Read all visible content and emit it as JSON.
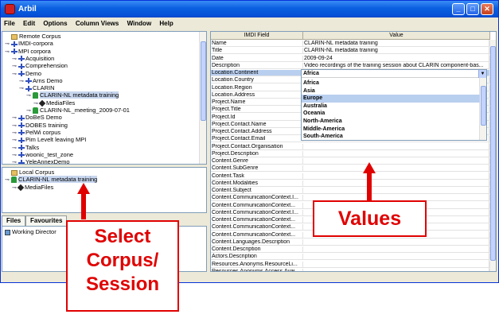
{
  "window": {
    "title": "Arbil"
  },
  "menubar": [
    "File",
    "Edit",
    "Options",
    "Column Views",
    "Window",
    "Help"
  ],
  "remote_tree": [
    {
      "label": "Remote Corpus",
      "icon": "folder-icon",
      "depth": 0
    },
    {
      "label": "IMDI-corpora",
      "icon": "corpus-node-icon",
      "depth": 0
    },
    {
      "label": "MPI corpora",
      "icon": "corpus-node-icon",
      "depth": 0
    },
    {
      "label": "Acquisition",
      "icon": "corpus-node-icon",
      "depth": 1
    },
    {
      "label": "Comprehension",
      "icon": "corpus-node-icon",
      "depth": 1
    },
    {
      "label": "Demo",
      "icon": "corpus-node-icon",
      "depth": 1
    },
    {
      "label": "Arns Demo",
      "icon": "corpus-node-icon",
      "depth": 2
    },
    {
      "label": "CLARIN",
      "icon": "corpus-node-icon",
      "depth": 2
    },
    {
      "label": "CLARIN-NL metadata training",
      "icon": "session-icon",
      "depth": 3,
      "selected": true
    },
    {
      "label": "MediaFiles",
      "icon": "mediafile-icon",
      "depth": 4
    },
    {
      "label": "CLARIN-NL_meeting_2009-07-01",
      "icon": "session-icon",
      "depth": 3
    },
    {
      "label": "DoBeS Demo",
      "icon": "corpus-node-icon",
      "depth": 1
    },
    {
      "label": "DOBES training",
      "icon": "corpus-node-icon",
      "depth": 1
    },
    {
      "label": "PelWi corpus",
      "icon": "corpus-node-icon",
      "depth": 1
    },
    {
      "label": "Pim Levelt leaving MPI",
      "icon": "corpus-node-icon",
      "depth": 1
    },
    {
      "label": "Talks",
      "icon": "corpus-node-icon",
      "depth": 1
    },
    {
      "label": "woonic_test_zone",
      "icon": "corpus-node-icon",
      "depth": 1
    },
    {
      "label": "YeleAnnexDemo",
      "icon": "corpus-node-icon",
      "depth": 1
    }
  ],
  "local_tree": [
    {
      "label": "Local Corpus",
      "icon": "folder-icon",
      "depth": 0
    },
    {
      "label": "CLARIN-NL metadata training",
      "icon": "session-icon",
      "depth": 0,
      "selected": true
    },
    {
      "label": "MediaFiles",
      "icon": "mediafile-icon",
      "depth": 1
    }
  ],
  "tabs": [
    "Files",
    "Favourites"
  ],
  "files_panel": {
    "item": "Working Director"
  },
  "grid": {
    "columns": [
      "IMDI Field",
      "Value"
    ],
    "rows": [
      [
        "Name",
        "CLARIN-NL metadata training"
      ],
      [
        "Title",
        "CLARIN-NL metadata training"
      ],
      [
        "Date",
        "2009-09-24"
      ],
      [
        "Description",
        "Video recordings of the training session about CLARIN component-bas..."
      ],
      [
        "Location.Continent",
        "Africa"
      ],
      [
        "Location.Country",
        ""
      ],
      [
        "Location.Region",
        ""
      ],
      [
        "Location.Address",
        ""
      ],
      [
        "Project.Name",
        ""
      ],
      [
        "Project.Title",
        ""
      ],
      [
        "Project.Id",
        ""
      ],
      [
        "Project.Contact.Name",
        ""
      ],
      [
        "Project.Contact.Address",
        ""
      ],
      [
        "Project.Contact.Email",
        ""
      ],
      [
        "Project.Contact.Organisation",
        ""
      ],
      [
        "Project.Description",
        ""
      ],
      [
        "Content.Genre",
        ""
      ],
      [
        "Content.SubGenre",
        ""
      ],
      [
        "Content.Task",
        ""
      ],
      [
        "Content.Modalities",
        ""
      ],
      [
        "Content.Subject",
        ""
      ],
      [
        "Content.CommunicationContext.I...",
        ""
      ],
      [
        "Content.CommunicationContext...",
        ""
      ],
      [
        "Content.CommunicationContext.I...",
        ""
      ],
      [
        "Content.CommunicationContext...",
        ""
      ],
      [
        "Content.CommunicationContext...",
        ""
      ],
      [
        "Content.CommunicationContext...",
        ""
      ],
      [
        "Content.Languages.Description",
        ""
      ],
      [
        "Content.Description",
        ""
      ],
      [
        "Actors.Description",
        ""
      ],
      [
        "Resources.Anonyms.ResourceLi...",
        ""
      ],
      [
        "Resources.Anonyms.Access.Avai...",
        ""
      ]
    ],
    "highlight_row": 4
  },
  "continent_dropdown": {
    "selected": "Africa",
    "options": [
      "Africa",
      "Asia",
      "Europe",
      "Australia",
      "Oceania",
      "North-America",
      "Middle-America",
      "South-America"
    ],
    "hover": "Europe"
  },
  "annotations": {
    "select_label": "Select\nCorpus/\nSession",
    "values_label": "Values"
  },
  "colors": {
    "annotation": "#e00000",
    "selection": "#b9cff0",
    "titlebar": "#0a5fe0"
  }
}
